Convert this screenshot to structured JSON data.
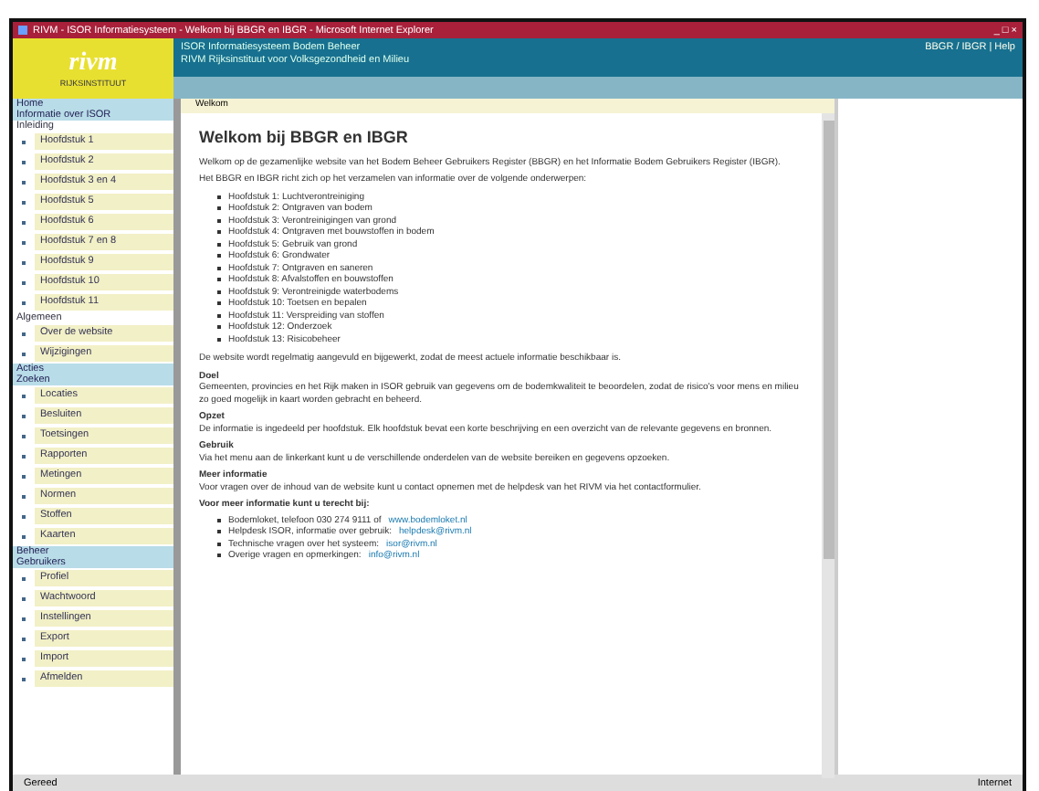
{
  "window": {
    "title": "RIVM - ISOR Informatiesysteem - Welkom bij BBGR en IBGR - Microsoft Internet Explorer",
    "controls": "_ □ ×"
  },
  "header": {
    "logo": "rivm",
    "logo_sub": "RIJKSINSTITUUT",
    "line1": "ISOR Informatiesysteem Bodem Beheer",
    "line2": "RIVM Rijksinstituut voor Volksgezondheid en Milieu",
    "links": "BBGR / IBGR | Help"
  },
  "sidebar": {
    "sections": [
      {
        "title": "Home",
        "subtitle": "Informatie over ISOR",
        "groups": [
          {
            "label": "Inleiding",
            "items": [
              "Hoofdstuk 1",
              "Hoofdstuk 2",
              "Hoofdstuk 3 en 4",
              "Hoofdstuk 5",
              "Hoofdstuk 6",
              "Hoofdstuk 7 en 8",
              "Hoofdstuk 9",
              "Hoofdstuk 10",
              "Hoofdstuk 11"
            ]
          },
          {
            "label": "Algemeen",
            "items": [
              "Over de website",
              "Wijzigingen"
            ]
          }
        ]
      },
      {
        "title": "Acties",
        "subtitle": "Zoeken",
        "groups": [
          {
            "items": [
              "Locaties",
              "Besluiten",
              "Toetsingen",
              "Rapporten",
              "Metingen",
              "Normen",
              "Stoffen",
              "Kaarten"
            ]
          }
        ]
      },
      {
        "title": "Beheer",
        "subtitle": "Gebruikers",
        "groups": [
          {
            "items": [
              "Profiel",
              "Wachtwoord",
              "Instellingen",
              "Export",
              "Import",
              "Afmelden"
            ]
          }
        ]
      }
    ]
  },
  "content": {
    "tab": "Welkom",
    "heading": "Welkom bij BBGR en IBGR",
    "intro": [
      "Welkom op de gezamenlijke website van het Bodem Beheer Gebruikers Register (BBGR) en het Informatie Bodem Gebruikers Register (IBGR).",
      "Het BBGR en IBGR richt zich op het verzamelen van informatie over de volgende onderwerpen:"
    ],
    "chapters": [
      "Hoofdstuk 1: Luchtverontreiniging",
      "Hoofdstuk 2: Ontgraven van bodem",
      "Hoofdstuk 3: Verontreinigingen van grond",
      "Hoofdstuk 4: Ontgraven met bouwstoffen in bodem",
      "Hoofdstuk 5: Gebruik van grond",
      "Hoofdstuk 6: Grondwater",
      "Hoofdstuk 7: Ontgraven en saneren",
      "Hoofdstuk 8: Afvalstoffen en bouwstoffen",
      "Hoofdstuk 9: Verontreinigde waterbodems",
      "Hoofdstuk 10: Toetsen en bepalen",
      "Hoofdstuk 11: Verspreiding van stoffen",
      "Hoofdstuk 12: Onderzoek",
      "Hoofdstuk 13: Risicobeheer"
    ],
    "outro": "De website wordt regelmatig aangevuld en bijgewerkt, zodat de meest actuele informatie beschikbaar is.",
    "sections": [
      {
        "title": "Doel",
        "text": "Gemeenten, provincies en het Rijk maken in ISOR gebruik van gegevens om de bodemkwaliteit te beoordelen, zodat de risico's voor mens en milieu zo goed mogelijk in kaart worden gebracht en beheerd."
      },
      {
        "title": "Opzet",
        "text": "De informatie is ingedeeld per hoofdstuk. Elk hoofdstuk bevat een korte beschrijving en een overzicht van de relevante gegevens en bronnen."
      },
      {
        "title": "Gebruik",
        "text": "Via het menu aan de linkerkant kunt u de verschillende onderdelen van de website bereiken en gegevens opzoeken."
      },
      {
        "title": "Meer informatie",
        "text": "Voor vragen over de inhoud van de website kunt u contact opnemen met de helpdesk van het RIVM via het contactformulier."
      }
    ],
    "contacts_title": "Voor meer informatie kunt u terecht bij:",
    "contacts": [
      {
        "text": "Bodemloket, telefoon 030 274 9111 of",
        "link": "www.bodemloket.nl"
      },
      {
        "text": "Helpdesk ISOR, informatie over gebruik:",
        "link": "helpdesk@rivm.nl"
      },
      {
        "text": "Technische vragen over het systeem:",
        "link": "isor@rivm.nl"
      },
      {
        "text": "Overige vragen en opmerkingen:",
        "link": "info@rivm.nl"
      }
    ]
  },
  "status_bar": {
    "text": "Gereed",
    "zone": "Internet"
  }
}
